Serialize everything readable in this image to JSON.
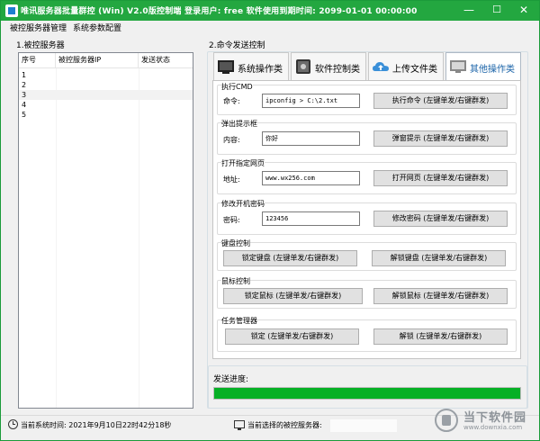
{
  "window": {
    "title": "唯讯服务器批量群控 (Win) V2.0版控制端   登录用户: free   软件使用到期时间: 2099-01-01 00:00:00",
    "minimize_glyph": "—",
    "maximize_glyph": "☐",
    "close_glyph": "✕"
  },
  "menu": {
    "items": [
      "被控服务器管理",
      "系统参数配置"
    ]
  },
  "left_panel": {
    "title": "1.被控服务器",
    "columns": [
      "序号",
      "被控服务器IP",
      "发送状态"
    ],
    "rows": [
      "1",
      "2",
      "3",
      "4",
      "5"
    ]
  },
  "right_panel": {
    "title": "2.命令发送控制",
    "tabs": [
      {
        "label": "系统操作类",
        "icon": "terminal-icon"
      },
      {
        "label": "软件控制类",
        "icon": "app-icon"
      },
      {
        "label": "上传文件类",
        "icon": "cloud-upload-icon"
      },
      {
        "label": "其他操作类",
        "icon": "monitor-icon"
      }
    ],
    "sections": {
      "cmd": {
        "title": "执行CMD",
        "field_label": "命令:",
        "value": "ipconfig > C:\\2.txt",
        "button": "执行命令 (左键单发/右键群发)"
      },
      "popup": {
        "title": "弹出提示框",
        "field_label": "内容:",
        "value": "你好",
        "button": "弹窗提示 (左键单发/右键群发)"
      },
      "webpage": {
        "title": "打开指定网页",
        "field_label": "地址:",
        "value": "www.wx256.com",
        "button": "打开网页 (左键单发/右键群发)"
      },
      "password": {
        "title": "修改开机密码",
        "field_label": "密码:",
        "value": "123456",
        "button": "修改密码 (左键单发/右键群发)"
      },
      "keyboard": {
        "title": "键盘控制",
        "lock_button": "锁定键盘 (左键单发/右键群发)",
        "unlock_button": "解锁键盘 (左键单发/右键群发)"
      },
      "mouse": {
        "title": "鼠标控制",
        "lock_button": "锁定鼠标 (左键单发/右键群发)",
        "unlock_button": "解锁鼠标 (左键单发/右键群发)"
      },
      "taskmgr": {
        "title": "任务管理器",
        "lock_button": "锁定 (左键单发/右键群发)",
        "unlock_button": "解锁 (左键单发/右键群发)"
      }
    }
  },
  "progress": {
    "label": "发送进度:",
    "fraction": 1.0,
    "color": "#06b025"
  },
  "status_bar": {
    "time_text": "当前系统时间: 2021年9月10日22时42分18秒",
    "selected_text": "当前选择的被控服务器:"
  },
  "watermark": {
    "line1": "当下软件园",
    "line2": "www.downxia.com"
  },
  "colors": {
    "titlebar": "#23a740",
    "progress": "#06b025",
    "active_tab_text": "#1a63a8"
  }
}
